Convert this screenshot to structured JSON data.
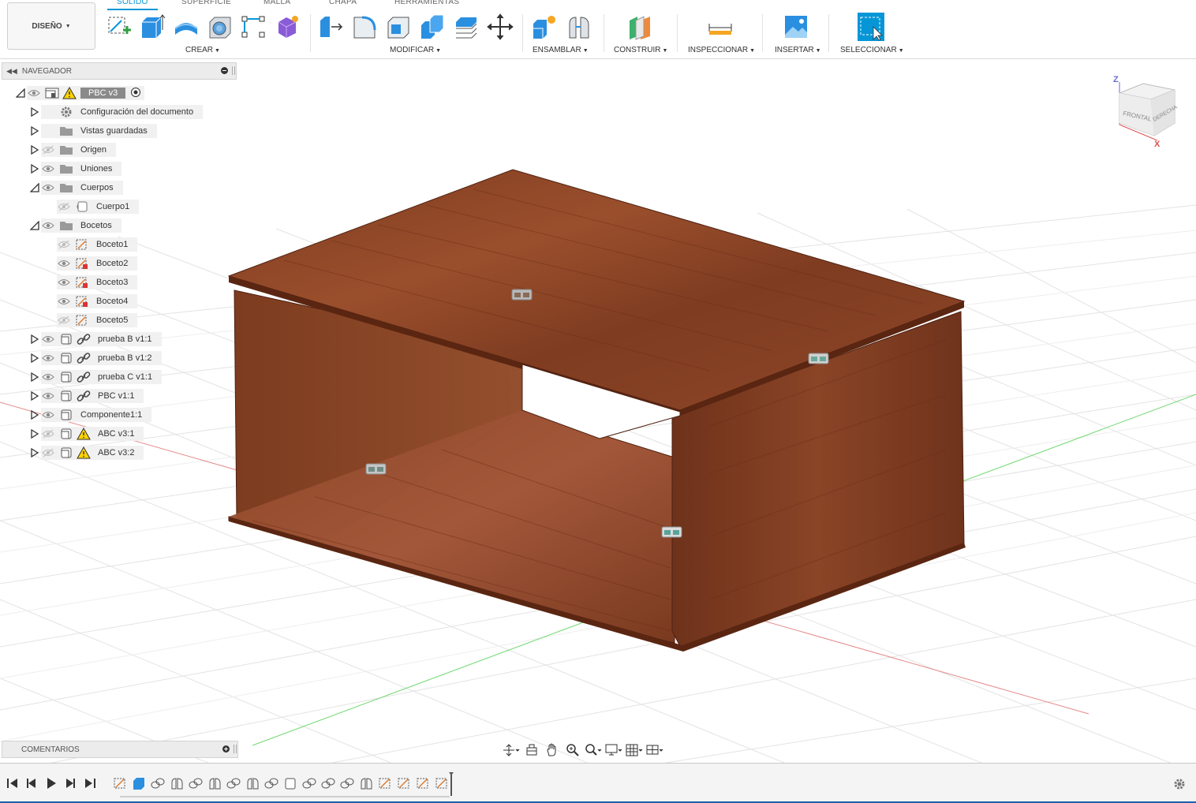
{
  "workspace_button": "DISEÑO",
  "tabs": [
    "SÓLIDO",
    "SUPERFICIE",
    "MALLA",
    "CHAPA",
    "HERRAMIENTAS"
  ],
  "groups": {
    "crear": "CREAR",
    "modificar": "MODIFICAR",
    "ensamblar": "ENSAMBLAR",
    "construir": "CONSTRUIR",
    "inspeccionar": "INSPECCIONAR",
    "insertar": "INSERTAR",
    "seleccionar": "SELECCIONAR"
  },
  "navigator": {
    "title": "NAVEGADOR",
    "root": "PBC v3",
    "items": [
      {
        "label": "Configuración del documento"
      },
      {
        "label": "Vistas guardadas"
      },
      {
        "label": "Origen"
      },
      {
        "label": "Uniones"
      },
      {
        "label": "Cuerpos"
      },
      {
        "label": "Cuerpo1"
      },
      {
        "label": "Bocetos"
      },
      {
        "label": "Boceto1"
      },
      {
        "label": "Boceto2"
      },
      {
        "label": "Boceto3"
      },
      {
        "label": "Boceto4"
      },
      {
        "label": "Boceto5"
      },
      {
        "label": "prueba B v1:1"
      },
      {
        "label": "prueba B v1:2"
      },
      {
        "label": "prueba C v1:1"
      },
      {
        "label": "PBC v1:1"
      },
      {
        "label": "Componente1:1"
      },
      {
        "label": "ABC v3:1"
      },
      {
        "label": "ABC v3:2"
      }
    ]
  },
  "comments_panel": "COMENTARIOS",
  "viewcube": {
    "front": "FRONTAL",
    "right": "DERECHA",
    "axis_z": "Z",
    "axis_x": "X"
  },
  "colors": {
    "accent": "#0696d7",
    "wood_top": "#8a4326",
    "wood_side": "#7a3a1f",
    "warning": "#ffd400",
    "axis_red": "#e05252",
    "axis_green": "#4ccf4c"
  }
}
